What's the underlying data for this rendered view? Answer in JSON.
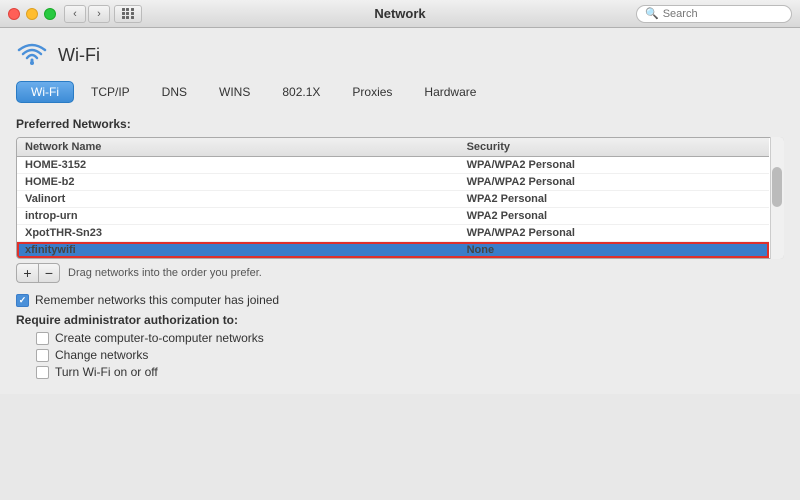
{
  "titleBar": {
    "title": "Network",
    "searchPlaceholder": "Search"
  },
  "wifi": {
    "title": "Wi-Fi",
    "tabs": [
      "Wi-Fi",
      "TCP/IP",
      "DNS",
      "WINS",
      "802.1X",
      "Proxies",
      "Hardware"
    ],
    "activeTab": "Wi-Fi"
  },
  "networks": {
    "sectionLabel": "Preferred Networks:",
    "columns": [
      "Network Name",
      "Security"
    ],
    "rows": [
      {
        "name": "HOME-3152",
        "security": "WPA/WPA2 Personal"
      },
      {
        "name": "HOME-b2",
        "security": "WPA/WPA2 Personal"
      },
      {
        "name": "Valinort",
        "security": "WPA2 Personal"
      },
      {
        "name": "introp-urn",
        "security": "WPA2 Personal"
      },
      {
        "name": "XpotTHR-Sn23",
        "security": "WPA/WPA2 Personal"
      },
      {
        "name": "xfinitywifi",
        "security": "None"
      }
    ],
    "selectedRow": 5,
    "highlightedRow": 5,
    "hint": "Drag networks into the order you prefer.",
    "addLabel": "+",
    "removeLabel": "−"
  },
  "options": {
    "rememberNetworks": {
      "label": "Remember networks this computer has joined",
      "checked": true
    },
    "requireAuth": {
      "label": "Require administrator authorization to:",
      "items": [
        {
          "label": "Create computer-to-computer networks",
          "checked": false
        },
        {
          "label": "Change networks",
          "checked": false
        },
        {
          "label": "Turn Wi-Fi on or off",
          "checked": false
        }
      ]
    }
  },
  "icons": {
    "back": "‹",
    "forward": "›",
    "search": "🔍"
  }
}
